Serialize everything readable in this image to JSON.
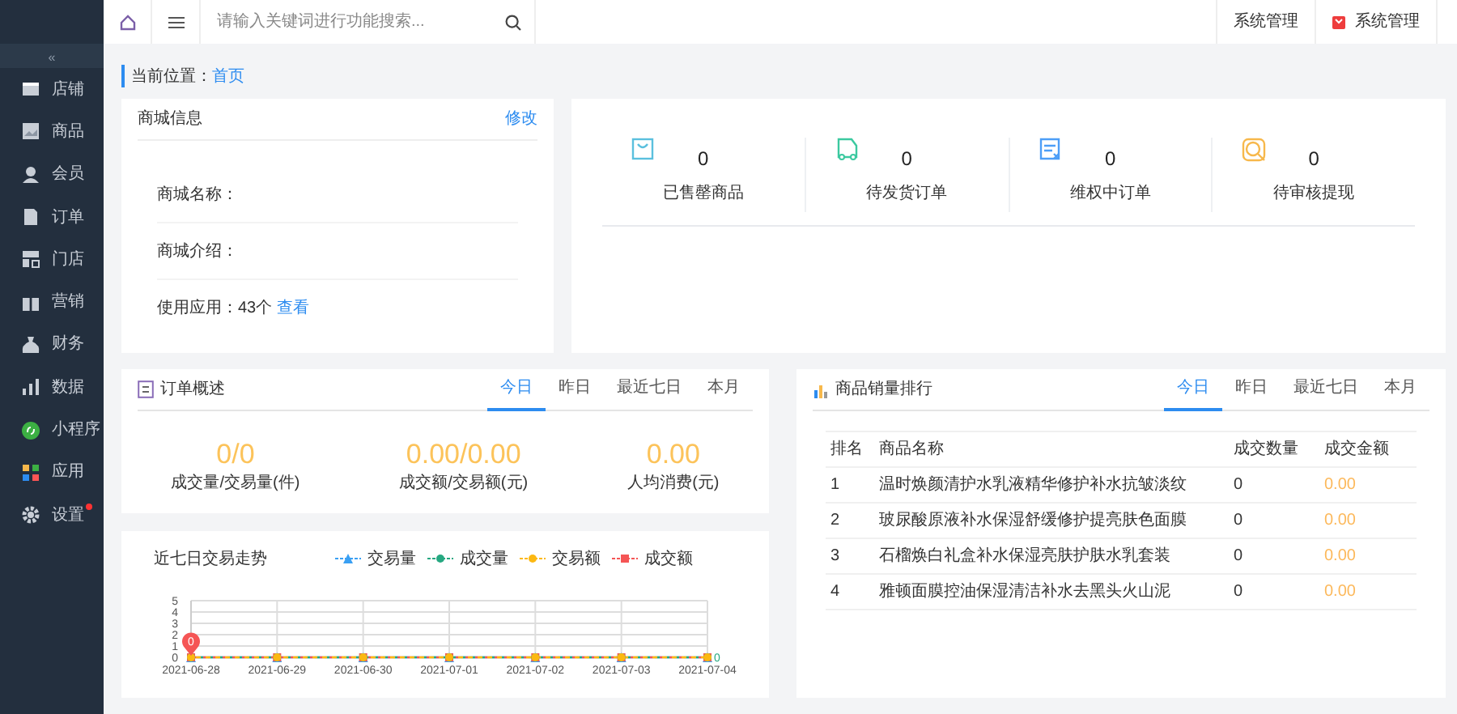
{
  "sidebar": {
    "collapse_icon": "«",
    "items": [
      {
        "label": "店铺",
        "dot": false
      },
      {
        "label": "商品",
        "dot": false
      },
      {
        "label": "会员",
        "dot": false
      },
      {
        "label": "订单",
        "dot": false
      },
      {
        "label": "门店",
        "dot": false
      },
      {
        "label": "营销",
        "dot": false
      },
      {
        "label": "财务",
        "dot": false
      },
      {
        "label": "数据",
        "dot": false
      },
      {
        "label": "小程序",
        "dot": false
      },
      {
        "label": "应用",
        "dot": false
      },
      {
        "label": "设置",
        "dot": true
      }
    ]
  },
  "topbar": {
    "search": {
      "placeholder": "请输入关键词进行功能搜索..."
    },
    "right_items": [
      {
        "label": "系统管理",
        "icon": false
      },
      {
        "label": "系统管理",
        "icon": true
      }
    ]
  },
  "breadcrumb": {
    "label": "当前位置：",
    "current": "首页"
  },
  "shop_info": {
    "title": "商城信息",
    "edit": "修改",
    "fields": [
      {
        "label": "商城名称："
      },
      {
        "label": "商城介绍："
      }
    ],
    "apps": {
      "label": "使用应用：",
      "count": "43个",
      "link": "查看"
    }
  },
  "stats": [
    {
      "value": "0",
      "label": "已售罄商品",
      "color": "#5bc0de"
    },
    {
      "value": "0",
      "label": "待发货订单",
      "color": "#3cc9a0"
    },
    {
      "value": "0",
      "label": "维权中订单",
      "color": "#4d9ef7"
    },
    {
      "value": "0",
      "label": "待审核提现",
      "color": "#f7b84b"
    }
  ],
  "order_overview": {
    "title": "订单概述",
    "tabs": [
      {
        "label": "今日",
        "selected": true
      },
      {
        "label": "昨日",
        "selected": false
      },
      {
        "label": "最近七日",
        "selected": false
      },
      {
        "label": "本月",
        "selected": false
      }
    ],
    "metrics": [
      {
        "value": "0/0",
        "label": "成交量/交易量(件)"
      },
      {
        "value": "0.00/0.00",
        "label": "成交额/交易额(元)"
      },
      {
        "value": "0.00",
        "label": "人均消费(元)"
      }
    ]
  },
  "trend": {
    "title": "近七日交易走势",
    "chart_data": {
      "type": "line",
      "categories": [
        "2021-06-28",
        "2021-06-29",
        "2021-06-30",
        "2021-07-01",
        "2021-07-02",
        "2021-07-03",
        "2021-07-04"
      ],
      "series": [
        {
          "name": "交易量",
          "color": "#3aa0f3",
          "values": [
            0,
            0,
            0,
            0,
            0,
            0,
            0
          ],
          "line_style": "dashed",
          "marker": "triangle"
        },
        {
          "name": "成交量",
          "color": "#26a881",
          "values": [
            0,
            0,
            0,
            0,
            0,
            0,
            0
          ],
          "line_style": "dashed",
          "marker": "circle"
        },
        {
          "name": "交易额",
          "color": "#fcb812",
          "values": [
            0,
            0,
            0,
            0,
            0,
            0,
            0
          ],
          "line_style": "dashed",
          "marker": "circle"
        },
        {
          "name": "成交额",
          "color": "#f55555",
          "values": [
            0,
            0,
            0,
            0,
            0,
            0,
            0
          ],
          "line_style": "dashed",
          "marker": "square"
        }
      ],
      "ylim": [
        0,
        5
      ],
      "yticks": [
        0,
        1,
        2,
        3,
        4,
        5
      ],
      "grid": true,
      "annotations": [
        {
          "x": "2021-06-28",
          "y": 0,
          "text": "0"
        },
        {
          "x": "2021-07-04",
          "y": 0,
          "text": "0"
        }
      ]
    }
  },
  "ranking": {
    "title": "商品销量排行",
    "tabs": [
      {
        "label": "今日",
        "selected": true
      },
      {
        "label": "昨日",
        "selected": false
      },
      {
        "label": "最近七日",
        "selected": false
      },
      {
        "label": "本月",
        "selected": false
      }
    ],
    "columns": [
      "排名",
      "商品名称",
      "成交数量",
      "成交金额"
    ],
    "rows": [
      [
        "1",
        "温时焕颜清护水乳液精华修护补水抗皱淡纹",
        "0",
        "0.00"
      ],
      [
        "2",
        "玻尿酸原液补水保湿舒缓修护提亮肤色面膜",
        "0",
        "0.00"
      ],
      [
        "3",
        "石榴焕白礼盒补水保湿亮肤护肤水乳套装",
        "0",
        "0.00"
      ],
      [
        "4",
        "雅顿面膜控油保湿清洁补水去黑头火山泥",
        "0",
        "0.00"
      ]
    ]
  }
}
